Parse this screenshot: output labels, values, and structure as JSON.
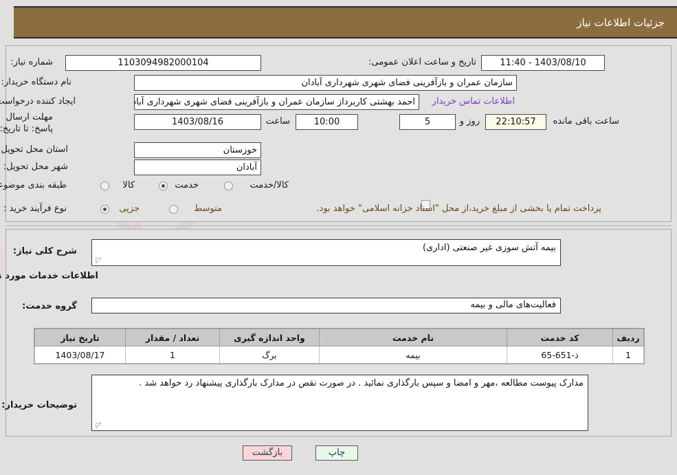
{
  "header": {
    "title": "جزئیات اطلاعات نیاز",
    "bg_color": "#8c6d40"
  },
  "top_section": {
    "need_number_label": "شماره نیاز:",
    "need_number_value": "1103094982000104",
    "announce_label": "تاریخ و ساعت اعلان عمومی:",
    "announce_value": "1403/08/10 - 11:40",
    "buyer_org_label": "نام دستگاه خریدار:",
    "buyer_org_value": "سازمان عمران و بازآفرینی فضای شهری شهرداری آبادان",
    "creator_label": "ایجاد کننده درخواست:",
    "creator_value": "احمد بهشتی کاربرداز سازمان عمران و بازآفرینی فضای شهری شهرداری آبادان",
    "contact_link": "اطلاعات تماس خریدار",
    "deadline_label": "مهلت ارسال پاسخ: تا تاریخ:",
    "deadline_date": "1403/08/16",
    "hour_label": "ساعت",
    "hour_value": "10:00",
    "days_value": "5",
    "days_label": "روز و",
    "countdown_value": "22:10:57",
    "remaining_label": "ساعت باقی مانده",
    "province_label": "استان محل تحویل:",
    "province_value": "خوزستان",
    "city_label": "شهر محل تحویل:",
    "city_value": "آبادان",
    "category_label": "طبقه بندی موضوعی:",
    "category_options": [
      "کالا",
      "خدمت",
      "کالا/خدمت"
    ],
    "category_selected": "خدمت",
    "process_label": "نوع فرآیند خرید :",
    "process_options": [
      "جزیی",
      "متوسط"
    ],
    "process_selected": "جزیی",
    "treasury_checkbox_text": "پرداخت تمام یا بخشی از مبلغ خرید،از محل \"اسناد خزانه اسلامی\" خواهد بود.",
    "treasury_checked": false,
    "link_color": "#7a3fbf"
  },
  "mid_section": {
    "overview_label": "شرح کلی نیاز:",
    "overview_value": "بیمه آتش سوزی غیر صنعتی (اداری)",
    "services_heading": "اطلاعات خدمات مورد نیاز",
    "service_group_label": "گروه خدمت:",
    "service_group_value": "فعالیت‌های مالی و بیمه",
    "table": {
      "headers": [
        "ردیف",
        "کد خدمت",
        "نام خدمت",
        "واحد اندازه گیری",
        "تعداد / مقدار",
        "تاریخ نیاز"
      ],
      "rows": [
        [
          "1",
          "ذ-651-65",
          "بیمه",
          "برگ",
          "1",
          "1403/08/17"
        ]
      ]
    },
    "buyer_notes_label": "توضیحات خریدار:",
    "buyer_notes_value": "مدارک پیوست مطالعه ،مهر و امضا و سپس بارگذاری نمائید . در صورت نقص در مدارک بارگذاری پیشنهاد رد خواهد شد ."
  },
  "footer": {
    "print_label": "چاپ",
    "back_label": "بازگشت"
  }
}
